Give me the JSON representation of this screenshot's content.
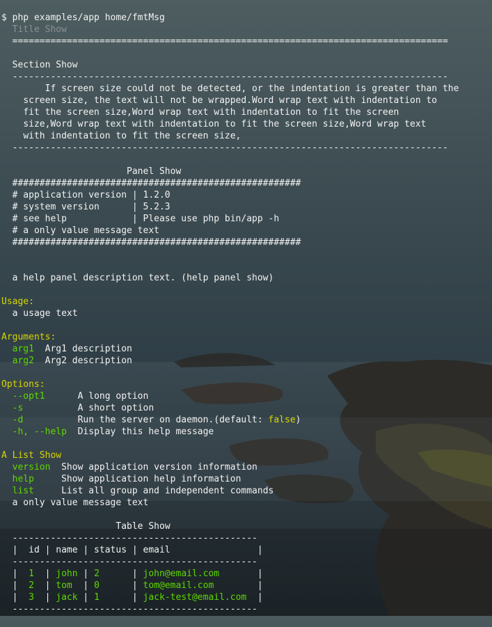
{
  "prompt": "$ php examples/app home/fmtMsg",
  "title_show": "Title Show",
  "title_rule": "================================================================================",
  "section": {
    "heading": "Section Show",
    "rule": "--------------------------------------------------------------------------------",
    "paragraph": [
      "    If screen size could not be detected, or the indentation is greater than the",
      "screen size, the text will not be wrapped.Word wrap text with indentation to",
      "fit the screen size,Word wrap text with indentation to fit the screen",
      "size,Word wrap text with indentation to fit the screen size,Word wrap text",
      "with indentation to fit the screen size,"
    ]
  },
  "panel": {
    "heading": "Panel Show",
    "border": "#####################################################",
    "rows": [
      "# application version | 1.2.0",
      "# system version      | 5.2.3",
      "# see help            | Please use php bin/app -h",
      "# a only value message text"
    ]
  },
  "help_desc": "a help panel description text. (help panel show)",
  "usage": {
    "heading": "Usage:",
    "text": "a usage text"
  },
  "arguments": {
    "heading": "Arguments:",
    "items": [
      {
        "name": "arg1",
        "pad": "  ",
        "desc": "Arg1 description"
      },
      {
        "name": "arg2",
        "pad": "  ",
        "desc": "Arg2 description"
      }
    ]
  },
  "options": {
    "heading": "Options:",
    "items": [
      {
        "name": "--opt1",
        "pad": "      ",
        "desc": "A long option",
        "extra": "",
        "close": ""
      },
      {
        "name": "-s",
        "pad": "          ",
        "desc": "A short option",
        "extra": "",
        "close": ""
      },
      {
        "name": "-d",
        "pad": "          ",
        "desc": "Run the server on daemon.(default: ",
        "extra": "false",
        "close": ")"
      },
      {
        "name": "-h, --help",
        "pad": "  ",
        "desc": "Display this help message",
        "extra": "",
        "close": ""
      }
    ]
  },
  "list": {
    "heading": "A List Show",
    "items": [
      {
        "name": "version",
        "pad": "  ",
        "desc": "Show application version information"
      },
      {
        "name": "help",
        "pad": "     ",
        "desc": "Show application help information"
      },
      {
        "name": "list",
        "pad": "     ",
        "desc": "List all group and independent commands"
      }
    ],
    "footer": "a only value message text"
  },
  "table": {
    "heading": "Table Show",
    "rule": "---------------------------------------------",
    "header": "|  id | name | status | email                |",
    "rows": [
      {
        "id": "1",
        "name": "john",
        "status": "2",
        "email": "john@email.com"
      },
      {
        "id": "2",
        "name": "tom",
        "status": "0",
        "email": "tom@email.com"
      },
      {
        "id": "3",
        "name": "jack",
        "status": "1",
        "email": "jack-test@email.com"
      }
    ]
  },
  "colors": {
    "heading_yellow": "#d7d700",
    "value_green": "#5fd700",
    "dim_title": "#8a9196"
  }
}
